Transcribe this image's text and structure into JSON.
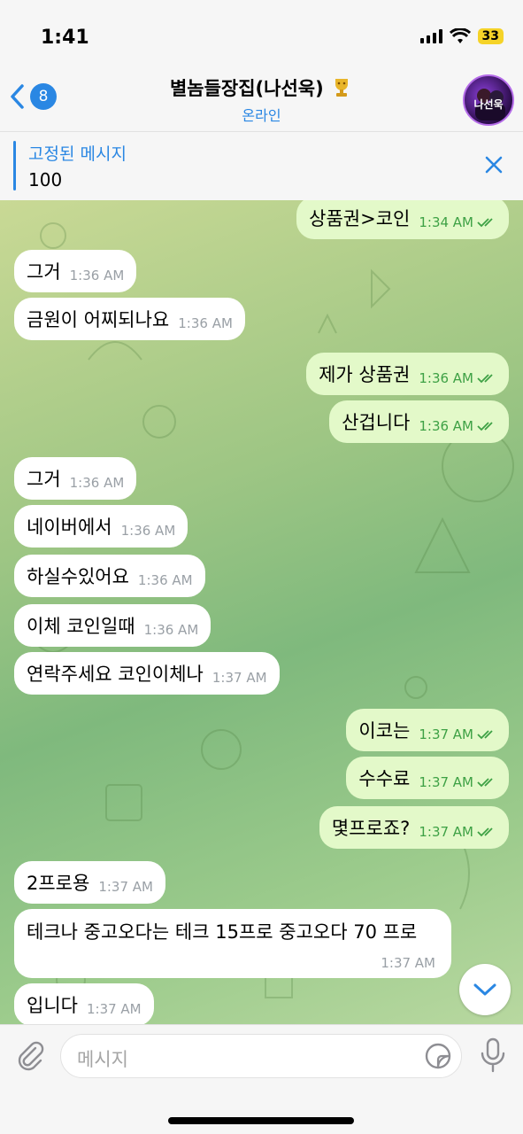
{
  "status_bar": {
    "time": "1:41",
    "battery": "33"
  },
  "header": {
    "back_count": "8",
    "title": "별놈들장집(나선욱)",
    "subtitle": "온라인",
    "avatar_text": "나선욱"
  },
  "pinned": {
    "title": "고정된 메시지",
    "text": "100"
  },
  "messages": [
    {
      "dir": "out",
      "text": "상품권>코인",
      "time": "1:34 AM",
      "read": true
    },
    {
      "dir": "in",
      "text": "그거",
      "time": "1:36 AM"
    },
    {
      "dir": "in",
      "text": "금원이 어찌되나요",
      "time": "1:36 AM"
    },
    {
      "dir": "out",
      "text": "제가 상품권",
      "time": "1:36 AM",
      "read": true
    },
    {
      "dir": "out",
      "text": "산겁니다",
      "time": "1:36 AM",
      "read": true
    },
    {
      "dir": "in",
      "text": "그거",
      "time": "1:36 AM"
    },
    {
      "dir": "in",
      "text": "네이버에서",
      "time": "1:36 AM"
    },
    {
      "dir": "in",
      "text": "하실수있어요",
      "time": "1:36 AM"
    },
    {
      "dir": "in",
      "text": "이체 코인일때",
      "time": "1:36 AM"
    },
    {
      "dir": "in",
      "text": "연락주세요 코인이체나",
      "time": "1:37 AM"
    },
    {
      "dir": "out",
      "text": "이코는",
      "time": "1:37 AM",
      "read": true
    },
    {
      "dir": "out",
      "text": "수수료",
      "time": "1:37 AM",
      "read": true
    },
    {
      "dir": "out",
      "text": "몇프로죠?",
      "time": "1:37 AM",
      "read": true
    },
    {
      "dir": "in",
      "text": "2프로용",
      "time": "1:37 AM"
    },
    {
      "dir": "in",
      "text": "테크나 중고오다는 테크 15프로 중고오다 70 프로",
      "time": "1:37 AM"
    },
    {
      "dir": "in",
      "text": "입니다",
      "time": "1:37 AM"
    }
  ],
  "composer": {
    "placeholder": "메시지"
  },
  "colors": {
    "accent": "#2a87e3",
    "outgoing_bubble": "#e3f9c9",
    "incoming_bubble": "#ffffff",
    "read_tick": "#3ea145"
  },
  "icons": {
    "back": "chevron-left-icon",
    "close": "close-icon",
    "attach": "paperclip-icon",
    "sticker": "sticker-icon",
    "mic": "microphone-icon",
    "scroll": "chevron-down-icon"
  }
}
